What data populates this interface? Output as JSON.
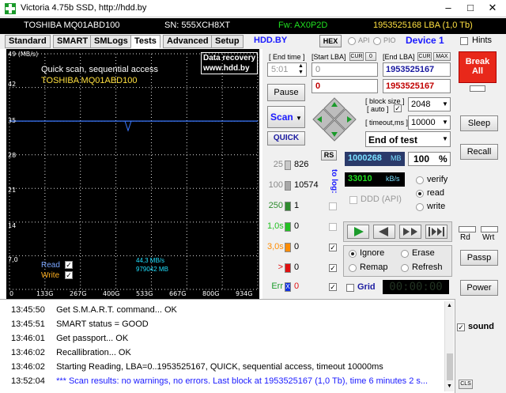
{
  "window": {
    "title": "Victoria 4.75b SSD, http://hdd.by"
  },
  "infobar": {
    "model": "TOSHIBA MQ01ABD100",
    "sn": "SN: 555XCH8XT",
    "fw": "Fw: AX0P2D",
    "lba": "1953525168 LBA (1,0 Tb)"
  },
  "tabs": [
    "Standard",
    "SMART",
    "SMLogs",
    "Tests",
    "Advanced",
    "Setup"
  ],
  "hddby": "HDD.BY",
  "hex": "HEX",
  "api": "API",
  "pio": "PIO",
  "device": "Device 1",
  "hints": "Hints",
  "graph": {
    "unit": "49 (MB/s)",
    "mode": "Quick scan, sequential access",
    "model": "TOSHIBA MQ01ABD100",
    "recovery_line1": "Data recovery",
    "recovery_line2": "www.hdd.by",
    "y_ticks": [
      "42",
      "35",
      "28",
      "21",
      "14",
      "7,0"
    ],
    "x_ticks": [
      "0",
      "133G",
      "267G",
      "400G",
      "533G",
      "667G",
      "800G",
      "934G"
    ],
    "read_label": "Read",
    "write_label": "Write",
    "speed": "44,3 MB/s",
    "pos": "979042 MB"
  },
  "mid": {
    "end_time_label": "[ End time ]",
    "start_lba_label": "[Start LBA]",
    "cur_label": "CUR",
    "zero_label": "0",
    "end_lba_label": "[End LBA]",
    "max_label": "MAX",
    "end_time_val": "5:01",
    "start_lba_val": "0",
    "end_lba_val": "1953525167",
    "start_lba_cur": "0",
    "end_lba_cur": "1953525167",
    "pause": "Pause",
    "scan": "Scan",
    "quick": "QUICK",
    "block_size_label": "[ block size ]",
    "auto_label": "[ auto ]",
    "block_size_val": "2048",
    "timeout_label": "[ timeout,ms ]",
    "timeout_val": "10000",
    "end_of_test": "End of test",
    "rs": "RS",
    "to_log": "to log:",
    "mb_val": "1000268",
    "mb_unit": "MB",
    "percent": "100",
    "percent_unit": "%",
    "kbs_val": "33010",
    "kbs_unit": "kB/s",
    "ddd_api": "DDD (API)",
    "verify": "verify",
    "read": "read",
    "write": "write",
    "ignore": "Ignore",
    "erase": "Erase",
    "remap": "Remap",
    "refresh": "Refresh",
    "grid": "Grid",
    "timer": "00:00:00",
    "counters": [
      {
        "label": "25",
        "count": "826",
        "color": "#c8c8c8"
      },
      {
        "label": "100",
        "count": "10574",
        "color": "#a8a8a8"
      },
      {
        "label": "250",
        "count": "1",
        "color": "#2e8b2e"
      },
      {
        "label": "1,0s",
        "count": "0",
        "color": "#22c022"
      },
      {
        "label": "3,0s",
        "count": "0",
        "color": "#ff8c00"
      },
      {
        "label": ">",
        "count": "0",
        "color": "#e01010"
      },
      {
        "label": "Err",
        "count": "0",
        "color": "#1030e0"
      }
    ]
  },
  "right": {
    "break_all": "Break\nAll",
    "break_line1": "Break",
    "break_line2": "All",
    "sleep": "Sleep",
    "recall": "Recall",
    "rd": "Rd",
    "wrt": "Wrt",
    "passp": "Passp",
    "power": "Power",
    "sound": "sound",
    "cls": "CLS"
  },
  "log": [
    {
      "time": "13:45:50",
      "text": "Get S.M.A.R.T. command... OK",
      "color": "#000000"
    },
    {
      "time": "13:45:51",
      "text": "SMART status = GOOD",
      "color": "#000000"
    },
    {
      "time": "13:46:01",
      "text": "Get passport... OK",
      "color": "#000000"
    },
    {
      "time": "13:46:02",
      "text": "Recallibration... OK",
      "color": "#000000"
    },
    {
      "time": "13:46:02",
      "text": "Starting Reading, LBA=0..1953525167, QUICK, sequential access, timeout 10000ms",
      "color": "#000000"
    },
    {
      "time": "13:52:04",
      "text": "*** Scan results: no warnings, no errors. Last block at 1953525167 (1,0 Tb), time 6 minutes 2 s...",
      "color": "#1a1aff"
    }
  ],
  "chart_data": {
    "type": "line",
    "x": [
      "0",
      "133G",
      "267G",
      "400G",
      "533G",
      "667G",
      "800G",
      "934G"
    ],
    "series": [
      {
        "values": [
          35,
          35,
          35,
          35,
          35,
          35,
          35,
          35
        ]
      }
    ],
    "ylim": [
      0,
      49
    ],
    "grid": true
  }
}
